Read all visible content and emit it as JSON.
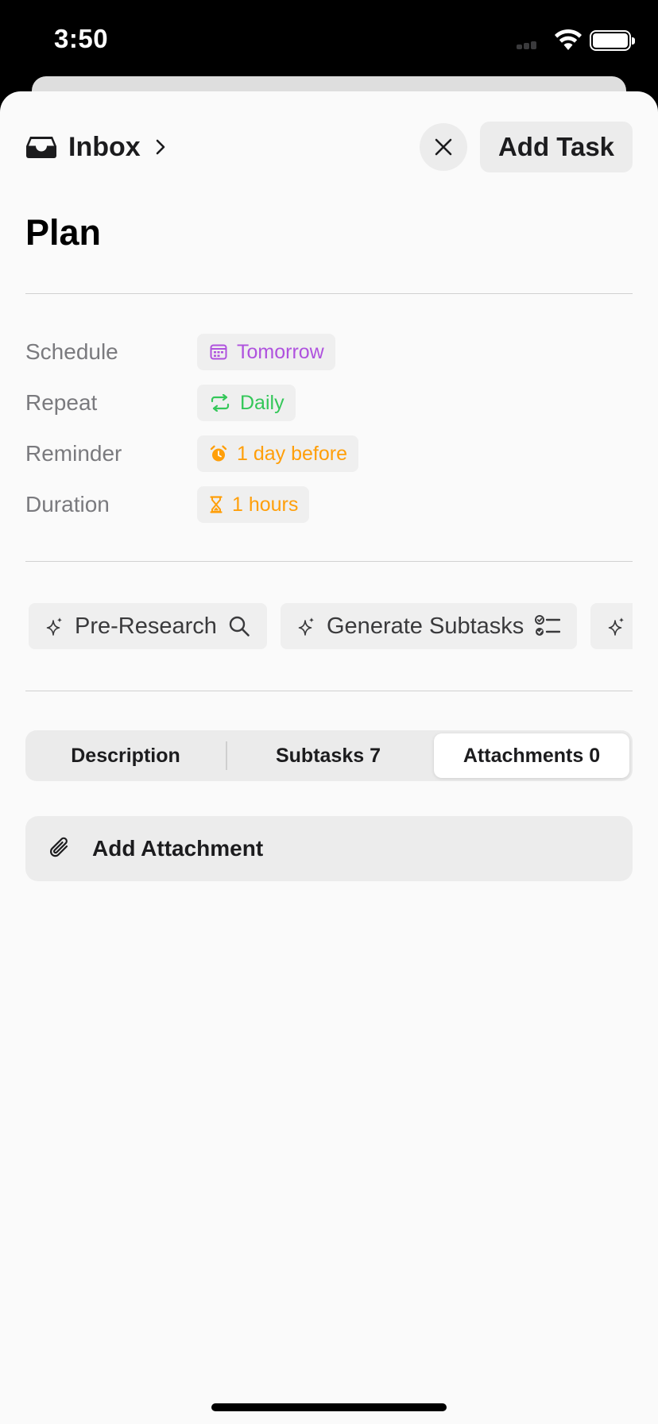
{
  "status_bar": {
    "time": "3:50"
  },
  "header": {
    "project_name": "Inbox",
    "close_icon": "close-icon",
    "add_task_label": "Add Task"
  },
  "task": {
    "title": "Plan"
  },
  "properties": [
    {
      "label": "Schedule",
      "value": "Tomorrow",
      "icon": "calendar-icon",
      "color": "#AF52DE"
    },
    {
      "label": "Repeat",
      "value": "Daily",
      "icon": "repeat-icon",
      "color": "#34C759"
    },
    {
      "label": "Reminder",
      "value": "1 day before",
      "icon": "alarm-clock-icon",
      "color": "#FF9F0A"
    },
    {
      "label": "Duration",
      "value": "1 hours",
      "icon": "hourglass-icon",
      "color": "#FF9F0A"
    }
  ],
  "ai_actions": [
    {
      "label": "Pre-Research",
      "icon": "magnifier-icon"
    },
    {
      "label": "Generate Subtasks",
      "icon": "checklist-icon"
    },
    {
      "label": "",
      "icon": "sparkle-icon"
    }
  ],
  "tabs": [
    {
      "label": "Description",
      "active": false
    },
    {
      "label": "Subtasks 7",
      "active": false
    },
    {
      "label": "Attachments 0",
      "active": true
    }
  ],
  "attachment": {
    "add_label": "Add Attachment",
    "icon": "paperclip-icon"
  },
  "colors": {
    "accent_purple": "#AF52DE",
    "accent_green": "#34C759",
    "accent_orange": "#FF9F0A"
  }
}
